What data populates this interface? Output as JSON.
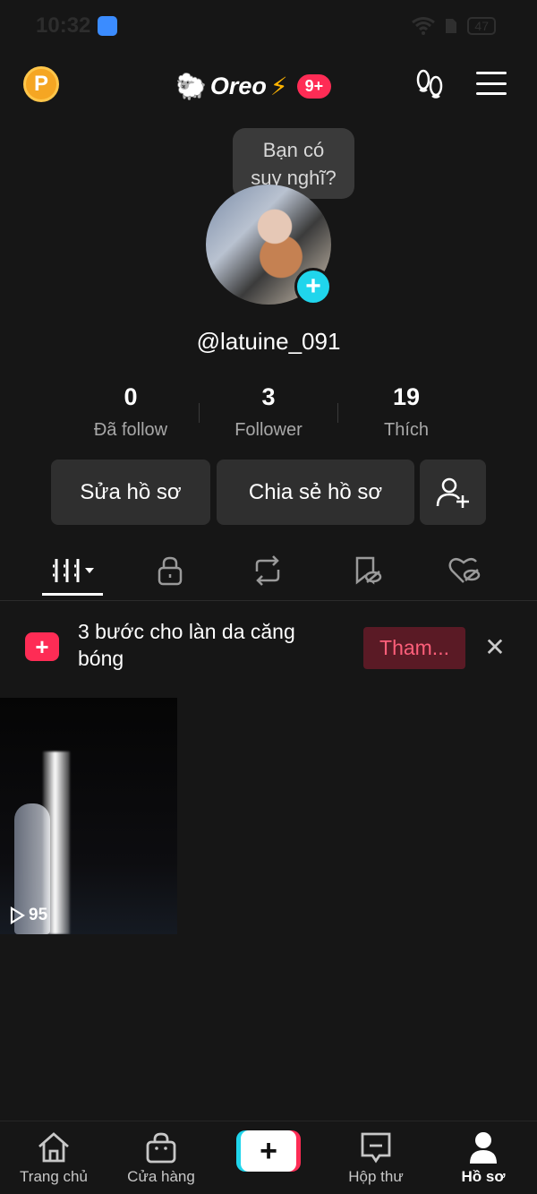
{
  "status_bar": {
    "time": "10:32",
    "battery": "47"
  },
  "header": {
    "username": "Oreo",
    "notification_count": "9+",
    "coin_label": "P"
  },
  "profile": {
    "thought_bubble": [
      "Bạn có",
      "suy nghĩ?"
    ],
    "handle": "@latuine_091",
    "avatar_add": "+"
  },
  "stats": [
    {
      "value": "0",
      "label": "Đã follow"
    },
    {
      "value": "3",
      "label": "Follower"
    },
    {
      "value": "19",
      "label": "Thích"
    }
  ],
  "actions": {
    "edit_profile": "Sửa hồ sơ",
    "share_profile": "Chia sẻ hồ sơ"
  },
  "tabs": [
    {
      "name": "videos-grid",
      "active": true
    },
    {
      "name": "private",
      "active": false
    },
    {
      "name": "reposts",
      "active": false
    },
    {
      "name": "favorites-hidden",
      "active": false
    },
    {
      "name": "liked-hidden",
      "active": false
    }
  ],
  "promo": {
    "text": "3 bước cho làn da căng bóng",
    "button": "Tham...",
    "icon": "+"
  },
  "videos": [
    {
      "views": "95"
    }
  ],
  "bottom_nav": {
    "home": "Trang chủ",
    "shop": "Cửa hàng",
    "create": "+",
    "inbox": "Hộp thư",
    "profile": "Hồ sơ"
  }
}
